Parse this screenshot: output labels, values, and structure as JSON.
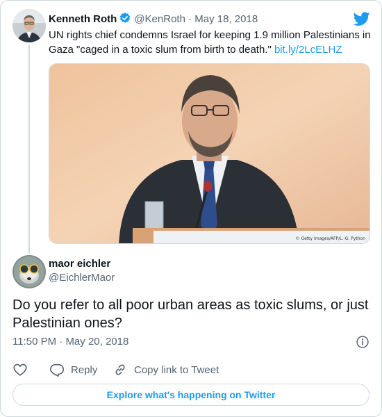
{
  "parent_tweet": {
    "author_name": "Kenneth Roth",
    "handle": "@KenRoth",
    "separator": " · ",
    "date": "May 18, 2018",
    "verified": true,
    "text": "UN rights chief condemns Israel for keeping 1.9 million Palestinians in Gaza \"caged in a toxic slum from birth to death.\" ",
    "link_text": "bit.ly/2LcELHZ",
    "image_credit": "© Getty Images/AFP/L.-G. Python"
  },
  "reply_tweet": {
    "author_name": "maor eichler",
    "handle": "@EichlerMaor",
    "text": "Do you refer to all poor urban areas as toxic slums, or just Palestinian ones?",
    "time": "11:50 PM",
    "separator": " · ",
    "date": "May 20, 2018"
  },
  "actions": {
    "reply_label": "Reply",
    "copy_link_label": "Copy link to Tweet"
  },
  "explore_button_label": "Explore what's happening on Twitter",
  "icons": {
    "brand": "twitter-bird-icon",
    "verified": "verified-badge-icon",
    "info": "info-icon",
    "like": "heart-icon",
    "reply": "speech-bubble-icon",
    "copy_link": "link-icon"
  },
  "colors": {
    "accent": "#1d9bf0",
    "text": "#0f1419",
    "muted": "#536471",
    "border": "#cfd9de"
  }
}
